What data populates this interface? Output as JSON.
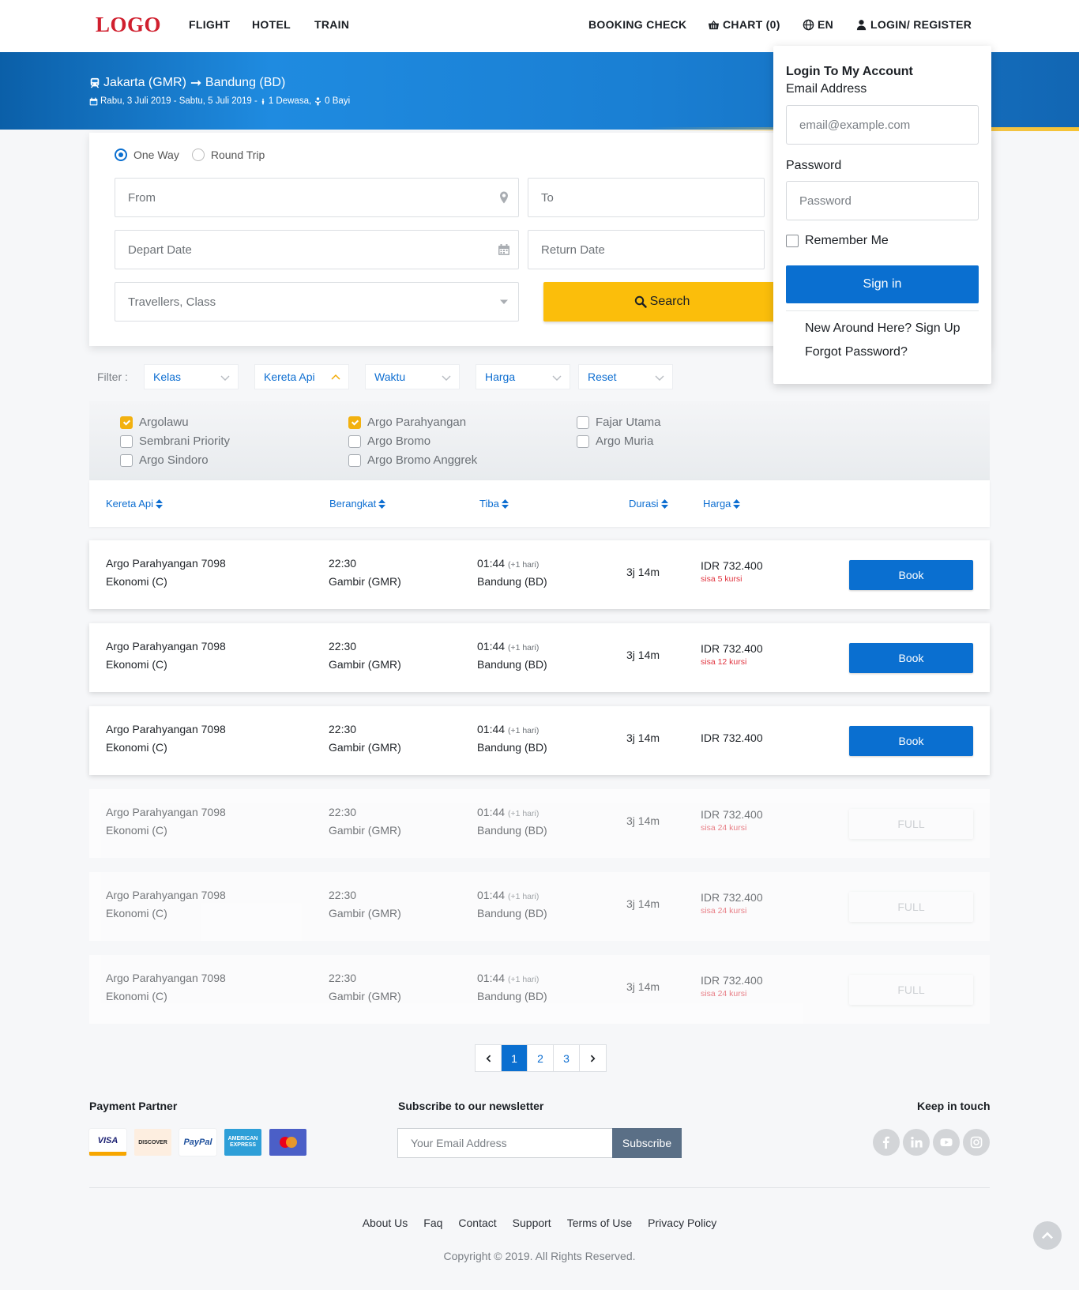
{
  "nav": {
    "logo": "LOGO",
    "flight": "FLIGHT",
    "hotel": "HOTEL",
    "train": "TRAIN",
    "booking_check": "BOOKING CHECK",
    "chart": "CHART (0)",
    "lang": "EN",
    "login": "LOGIN/ REGISTER"
  },
  "trip": {
    "route_from": "Jakarta (GMR)",
    "route_to": "Bandung (BD)",
    "dates": "Rabu, 3 Juli 2019 - Sabtu, 5 Juli 2019 -",
    "adults": "1 Dewasa,",
    "infants": "0 Bayi"
  },
  "search": {
    "one_way": "One Way",
    "round_trip": "Round Trip",
    "selected_trip_type": "One Way",
    "from_placeholder": "From",
    "to_placeholder": "To",
    "depart_placeholder": "Depart Date",
    "return_placeholder": "Return Date",
    "travellers_placeholder": "Travellers, Class",
    "search_button": "Search"
  },
  "filters": {
    "label": "Filter :",
    "items": [
      {
        "label": "Kelas",
        "open": false
      },
      {
        "label": "Kereta Api",
        "open": true
      },
      {
        "label": "Waktu",
        "open": false
      },
      {
        "label": "Harga",
        "open": false
      },
      {
        "label": "Reset",
        "open": false
      }
    ]
  },
  "train_options": [
    {
      "label": "Argolawu",
      "checked": true
    },
    {
      "label": "Sembrani Priority",
      "checked": false
    },
    {
      "label": "Argo Sindoro",
      "checked": false
    },
    {
      "label": "Argo Parahyangan",
      "checked": true
    },
    {
      "label": "Argo Bromo",
      "checked": false
    },
    {
      "label": "Argo Bromo Anggrek",
      "checked": false
    },
    {
      "label": "Fajar Utama",
      "checked": false
    },
    {
      "label": "Argo Muria",
      "checked": false
    }
  ],
  "table": {
    "headers": [
      "Kereta Api",
      "Berangkat",
      "Tiba",
      "Durasi",
      "Harga"
    ],
    "rows": [
      {
        "train": "Argo Parahyangan 7098",
        "class": "Ekonomi (C)",
        "dep_time": "22:30",
        "dep_station": "Gambir (GMR)",
        "arr_time": "01:44",
        "arr_hint": "(+1 hari)",
        "arr_station": "Bandung (BD)",
        "duration": "3j 14m",
        "price": "IDR 732.400",
        "seats": "sisa 5 kursi",
        "action": "Book",
        "status": "available"
      },
      {
        "train": "Argo Parahyangan 7098",
        "class": "Ekonomi (C)",
        "dep_time": "22:30",
        "dep_station": "Gambir (GMR)",
        "arr_time": "01:44",
        "arr_hint": "(+1 hari)",
        "arr_station": "Bandung (BD)",
        "duration": "3j 14m",
        "price": "IDR 732.400",
        "seats": "sisa 12 kursi",
        "action": "Book",
        "status": "available"
      },
      {
        "train": "Argo Parahyangan 7098",
        "class": "Ekonomi (C)",
        "dep_time": "22:30",
        "dep_station": "Gambir (GMR)",
        "arr_time": "01:44",
        "arr_hint": "(+1 hari)",
        "arr_station": "Bandung (BD)",
        "duration": "3j 14m",
        "price": "IDR 732.400",
        "seats": "",
        "action": "Book",
        "status": "available"
      },
      {
        "train": "Argo Parahyangan 7098",
        "class": "Ekonomi (C)",
        "dep_time": "22:30",
        "dep_station": "Gambir (GMR)",
        "arr_time": "01:44",
        "arr_hint": "(+1 hari)",
        "arr_station": "Bandung (BD)",
        "duration": "3j 14m",
        "price": "IDR 732.400",
        "seats": "sisa 24 kursi",
        "action": "FULL",
        "status": "full"
      },
      {
        "train": "Argo Parahyangan 7098",
        "class": "Ekonomi (C)",
        "dep_time": "22:30",
        "dep_station": "Gambir (GMR)",
        "arr_time": "01:44",
        "arr_hint": "(+1 hari)",
        "arr_station": "Bandung (BD)",
        "duration": "3j 14m",
        "price": "IDR 732.400",
        "seats": "sisa 24 kursi",
        "action": "FULL",
        "status": "full"
      },
      {
        "train": "Argo Parahyangan 7098",
        "class": "Ekonomi (C)",
        "dep_time": "22:30",
        "dep_station": "Gambir (GMR)",
        "arr_time": "01:44",
        "arr_hint": "(+1 hari)",
        "arr_station": "Bandung (BD)",
        "duration": "3j 14m",
        "price": "IDR 732.400",
        "seats": "sisa 24 kursi",
        "action": "FULL",
        "status": "full"
      }
    ]
  },
  "pagination": {
    "pages": [
      "1",
      "2",
      "3"
    ],
    "current": "1"
  },
  "footer": {
    "payment_title": "Payment Partner",
    "payments": [
      {
        "name": "VISA",
        "bg": "#ffffff",
        "color": "#1a1f71"
      },
      {
        "name": "DISCOVER",
        "bg": "#fdeee0",
        "color": "#222222"
      },
      {
        "name": "PayPal",
        "bg": "#ffffff",
        "color": "#1d4f9c"
      },
      {
        "name": "AMERICAN EXPRESS",
        "bg": "#2e9fd8",
        "color": "#ffffff"
      },
      {
        "name": "mastercard",
        "bg": "#4b5fc7",
        "color": "#ffffff"
      }
    ],
    "newsletter_title": "Subscribe to our newsletter",
    "newsletter_placeholder": "Your Email Address",
    "subscribe_button": "Subscribe",
    "keep_title": "Keep in touch",
    "social": [
      "facebook-icon",
      "linkedin-icon",
      "youtube-icon",
      "instagram-icon"
    ],
    "links": [
      "About Us",
      "Faq",
      "Contact",
      "Support",
      "Terms of Use",
      "Privacy Policy"
    ],
    "copyright": "Copyright © 2019. All Rights Reserved."
  },
  "login": {
    "title": "Login To My Account",
    "email_label": "Email Address",
    "email_placeholder": "email@example.com",
    "password_label": "Password",
    "password_placeholder": "Password",
    "remember": "Remember Me",
    "sign_in": "Sign in",
    "signup_link": "New Around Here? Sign Up",
    "forgot_link": "Forgot Password?"
  },
  "colors": {
    "primary": "#0a6fd0",
    "accent": "#fbbe0b",
    "danger": "#e0343f",
    "logo": "#d01f2e"
  }
}
